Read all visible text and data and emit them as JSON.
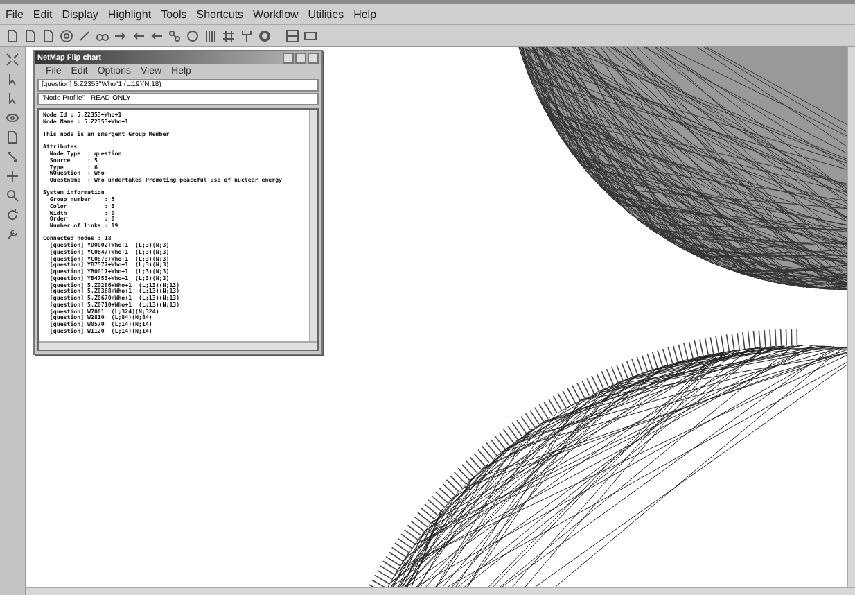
{
  "menu": [
    "File",
    "Edit",
    "Display",
    "Highlight",
    "Tools",
    "Shortcuts",
    "Workflow",
    "Utilities",
    "Help"
  ],
  "flip_window": {
    "title": "NetMap Flip chart",
    "menu": [
      "File",
      "Edit",
      "Options",
      "View",
      "Help"
    ],
    "node_field": "[question] 5.Z2353\"Who\"1 (L:19)(N:18)",
    "profile_field": "\"Node Profile\" - READ-ONLY",
    "lines": [
      {
        "kind": "text",
        "text": "Node Id : 5.Z2353+Who+1"
      },
      {
        "kind": "text",
        "text": "Node Name : 5.Z2353+Who+1"
      },
      {
        "kind": "gap"
      },
      {
        "kind": "text",
        "text": "This node is an Emergent Group Member"
      },
      {
        "kind": "gap"
      },
      {
        "kind": "text",
        "text": "Attributes"
      },
      {
        "kind": "text",
        "text": "  Node Type  : question"
      },
      {
        "kind": "text",
        "text": "  Source     : 5"
      },
      {
        "kind": "text",
        "text": "  Type       : 6"
      },
      {
        "kind": "text",
        "text": "  WQuestion  : Who"
      },
      {
        "kind": "text",
        "text": "  Questname  : Who undertakes Promoting peaceful use of nuclear energy"
      },
      {
        "kind": "gap"
      },
      {
        "kind": "text",
        "text": "System information"
      },
      {
        "kind": "text",
        "text": "  Group number    : 5"
      },
      {
        "kind": "text",
        "text": "  Color           : 3"
      },
      {
        "kind": "text",
        "text": "  Width           : 0"
      },
      {
        "kind": "text",
        "text": "  Order           : 0"
      },
      {
        "kind": "text",
        "text": "  Number of links : 19"
      },
      {
        "kind": "gap"
      },
      {
        "kind": "text",
        "text": "Connected nodes : 18"
      },
      {
        "kind": "text",
        "text": "  [question] YD0002+Who+1  (L;3)(N;3)"
      },
      {
        "kind": "text",
        "text": "  [question] YC0647+Who+1  (L;3)(N;3)"
      },
      {
        "kind": "text",
        "text": "  [question] YC0873+Who+1  (L;3)(N;3)"
      },
      {
        "kind": "text",
        "text": "  [question] YB7577+Who+1  (L;3)(N;3)"
      },
      {
        "kind": "text",
        "text": "  [question] YB0017+Who+1  (L;3)(N;3)"
      },
      {
        "kind": "text",
        "text": "  [question] YB4753+Who+1  (L;3)(N;3)"
      },
      {
        "kind": "text",
        "text": "  [question] 5.Z0286+Who+1  (L;13)(N;13)"
      },
      {
        "kind": "text",
        "text": "  [question] 5.Z0368+Who+1  (L;13)(N;13)"
      },
      {
        "kind": "text",
        "text": "  [question] 5.Z0670+Who+1  (L;13)(N;13)"
      },
      {
        "kind": "text",
        "text": "  [question] 5.Z0710+Who+1  (L;13)(N;13)"
      },
      {
        "kind": "text",
        "text": "  [question] W7001  (L;324)(N;324)"
      },
      {
        "kind": "text",
        "text": "  [question] W2810  (L;84)(N;84)"
      },
      {
        "kind": "text",
        "text": "  [question] W0570  (L;14)(N;14)"
      },
      {
        "kind": "text",
        "text": "  [question] W1120  (L;14)(N;14)"
      }
    ]
  }
}
